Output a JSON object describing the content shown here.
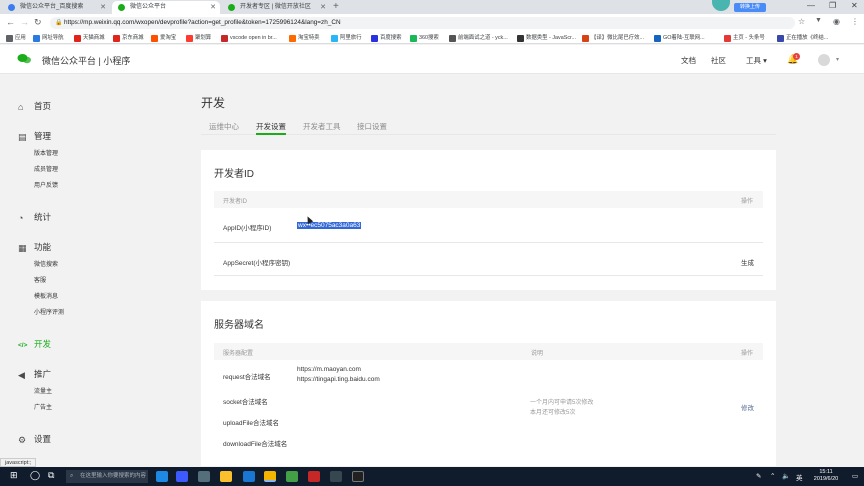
{
  "browser": {
    "tabs": [
      {
        "title": "微信公众平台_百度搜索",
        "active": false
      },
      {
        "title": "微信公众平台",
        "active": true
      },
      {
        "title": "开发者专区 | 微信开放社区",
        "active": false
      }
    ],
    "extension_label": "转换上传",
    "url": "https://mp.weixin.qq.com/wxopen/devprofile?action=get_profile&token=1725996124&lang=zh_CN",
    "bookmarks": [
      {
        "label": "应用",
        "color": "#5f6368"
      },
      {
        "label": "网址导航",
        "color": "#2a7ae2"
      },
      {
        "label": "天猫商城",
        "color": "#e2231a"
      },
      {
        "label": "京东商城",
        "color": "#e1251b"
      },
      {
        "label": "爱淘宝",
        "color": "#ff5000"
      },
      {
        "label": "聚划算",
        "color": "#ff3b30"
      },
      {
        "label": "vscode open in br...",
        "color": "#c62828"
      },
      {
        "label": "淘宝特卖",
        "color": "#ff6a00"
      },
      {
        "label": "阿里旅行",
        "color": "#29b6f6"
      },
      {
        "label": "百度搜索",
        "color": "#2932e1"
      },
      {
        "label": "360搜索",
        "color": "#19b955"
      },
      {
        "label": "前端面试之道 - yck...",
        "color": "#555555"
      },
      {
        "label": "数据类型 - JavaScr...",
        "color": "#333333"
      },
      {
        "label": "【译】微比尾巴疗效...",
        "color": "#d84315"
      },
      {
        "label": "GO着陆-互联网...",
        "color": "#1565c0"
      },
      {
        "label": "主页 - 头条号",
        "color": "#e53935"
      },
      {
        "label": "正在播放《终结...",
        "color": "#3949ab"
      }
    ]
  },
  "header": {
    "brand": "微信公众平台  |  小程序",
    "nav": [
      "文档",
      "社区",
      "工具 ▾"
    ],
    "notification_count": "1"
  },
  "sidebar": {
    "sections": [
      {
        "label": "首页",
        "icon": "⌂",
        "items": []
      },
      {
        "label": "管理",
        "icon": "▤",
        "items": [
          "版本管理",
          "成员管理",
          "用户反馈"
        ]
      },
      {
        "label": "统计",
        "icon": "◔",
        "items": []
      },
      {
        "label": "功能",
        "icon": "▦",
        "items": [
          "微信搜索",
          "客服",
          "模板消息",
          "小程序评测"
        ]
      },
      {
        "label": "开发",
        "icon": "</>",
        "items": [],
        "active": true
      },
      {
        "label": "推广",
        "icon": "◀",
        "items": [
          "流量主",
          "广告主"
        ]
      },
      {
        "label": "设置",
        "icon": "⚙",
        "items": []
      }
    ]
  },
  "main": {
    "title": "开发",
    "tabs": [
      "运维中心",
      "开发设置",
      "开发者工具",
      "接口设置"
    ],
    "active_tab": 1,
    "developer_id": {
      "title": "开发者ID",
      "col_id": "开发者ID",
      "col_action": "操作",
      "appid_label": "AppID(小程序ID)",
      "appid_value": "wx••ec5075ac3a0a63",
      "secret_label": "AppSecret(小程序密钥)",
      "secret_action": "生成"
    },
    "server_domain": {
      "title": "服务器域名",
      "col_config": "服务器配置",
      "col_desc": "说明",
      "col_action": "操作",
      "request_label": "request合法域名",
      "request_domains": [
        "https://m.maoyan.com",
        "https://tingapi.ting.baidu.com"
      ],
      "socket_label": "socket合法域名",
      "upload_label": "uploadFile合法域名",
      "download_label": "downloadFile合法域名",
      "desc_line1": "一个月内可申请5次修改",
      "desc_line2": "本月还可修改5次",
      "modify_label": "修改"
    }
  },
  "statusbar": "javascript:;",
  "taskbar": {
    "search_placeholder": "在这里输入你要搜索的内容",
    "time": "15:11",
    "date": "2019/6/20",
    "ime": "英"
  }
}
